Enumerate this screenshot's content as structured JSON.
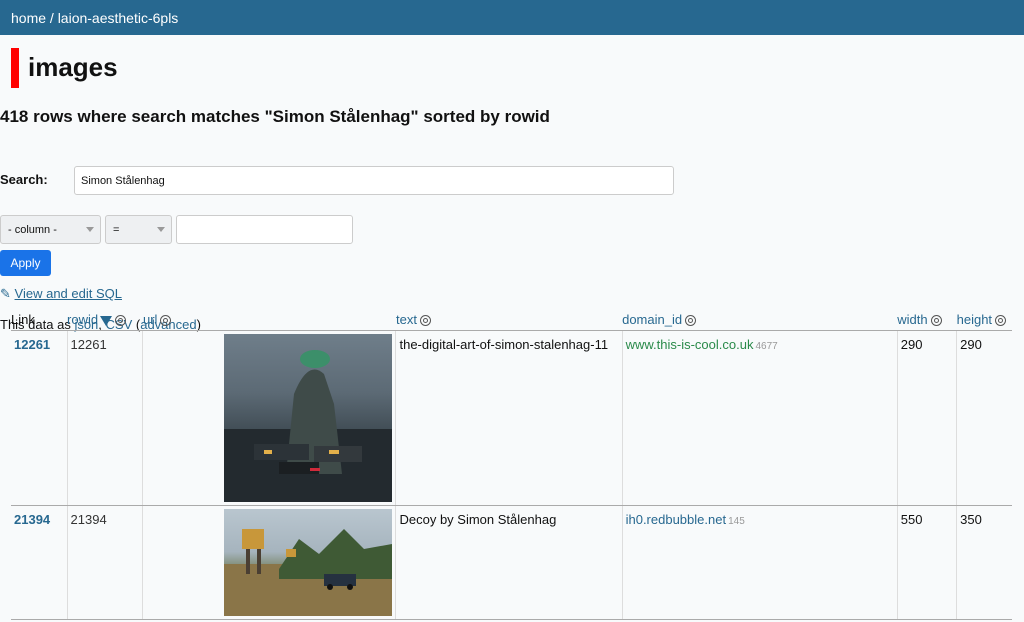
{
  "breadcrumb": "home / laion-aesthetic-6pls",
  "page_title": "images",
  "row_count_text": "418 rows where search matches \"Simon Stålenhag\" sorted by rowid",
  "search": {
    "label": "Search:",
    "value": "Simon Stålenhag"
  },
  "filter": {
    "column_select": "- column -",
    "op_select": "=",
    "value": ""
  },
  "apply_label": "Apply",
  "sql_link": {
    "pencil": "✎",
    "label": "View and edit SQL"
  },
  "export": {
    "prefix": "This data as ",
    "json": "json",
    "sep": ", ",
    "csv": "CSV",
    "open": " (",
    "advanced": "advanced",
    "close": ")"
  },
  "columns": {
    "link": "Link",
    "rowid": "rowid",
    "url": "url",
    "text": "text",
    "domain_id": "domain_id",
    "width": "width",
    "height": "height"
  },
  "rows": [
    {
      "link": "12261",
      "rowid": "12261",
      "text": "the-digital-art-of-simon-stalenhag-11",
      "domain": "www.this-is-cool.co.uk",
      "domain_fk": "4677",
      "width": "290",
      "height": "290"
    },
    {
      "link": "21394",
      "rowid": "21394",
      "text": "Decoy by Simon Stålenhag",
      "domain": "ih0.redbubble.net",
      "domain_fk": "145",
      "width": "550",
      "height": "350"
    }
  ],
  "colors": {
    "header_bar": "#276890",
    "accent": "#ff0000",
    "apply": "#1a73e8"
  }
}
